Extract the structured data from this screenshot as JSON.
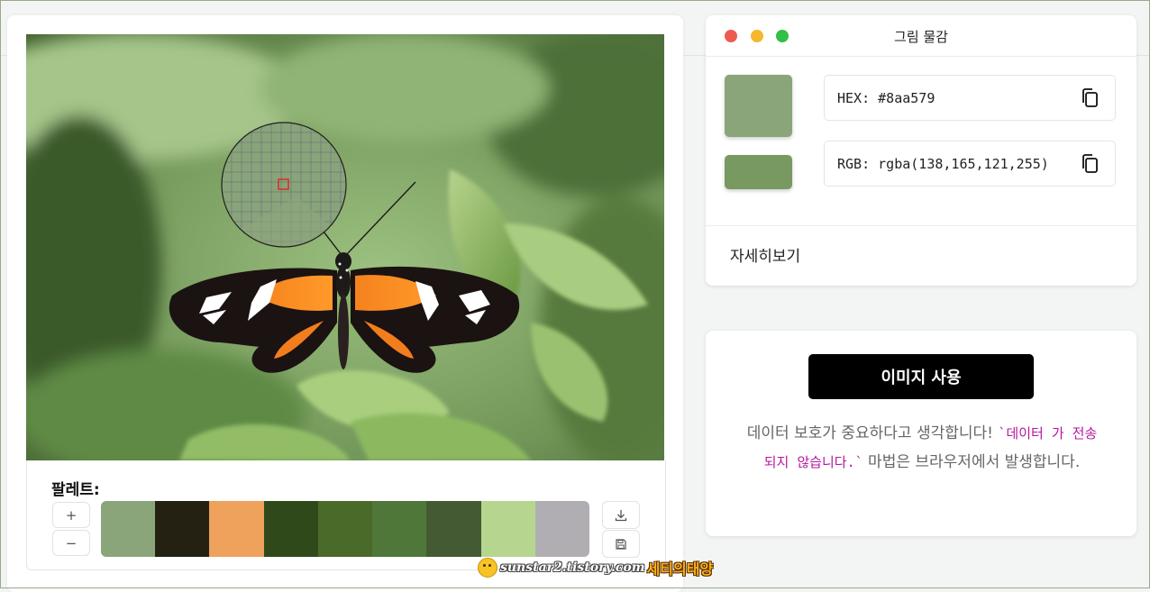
{
  "window": {
    "title": "그림 물감",
    "dots": [
      "#ee5a52",
      "#f5b72c",
      "#31c048"
    ]
  },
  "image": {
    "description_icon": "butterfly-photo"
  },
  "palette": {
    "label": "팔레트:",
    "add_label": "+",
    "remove_label": "−",
    "colors": [
      "#8aa579",
      "#242113",
      "#eea25b",
      "#2f491b",
      "#4a6a2a",
      "#50773a",
      "#445a33",
      "#b6d690",
      "#b0aeb3"
    ]
  },
  "color": {
    "selected": "#8aa579",
    "secondary": "#789960",
    "hex_text": "HEX: #8aa579",
    "rgb_text": "RGB: rgba(138,165,121,255)"
  },
  "details_label": "자세히보기",
  "cta": {
    "button_label": "이미지 사용",
    "privacy_prefix": "데이터 보호가 중요하다고 생각합니다! ",
    "privacy_code": "`데이터 가 전송되지 않습니다.`",
    "privacy_suffix": " 마법은 브라우저에서 발생합니다."
  },
  "watermark": {
    "url": "sunstar2.tistory.com",
    "name": "세티의태양"
  }
}
